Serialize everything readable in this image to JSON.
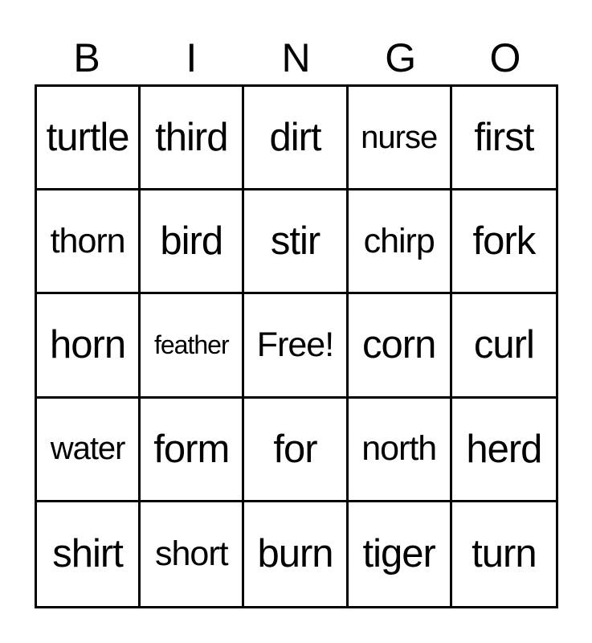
{
  "header": {
    "letters": [
      "B",
      "I",
      "N",
      "G",
      "O"
    ]
  },
  "board": {
    "rows": [
      [
        "turtle",
        "third",
        "dirt",
        "nurse",
        "first"
      ],
      [
        "thorn",
        "bird",
        "stir",
        "chirp",
        "fork"
      ],
      [
        "horn",
        "feather",
        "Free!",
        "corn",
        "curl"
      ],
      [
        "water",
        "form",
        "for",
        "north",
        "herd"
      ],
      [
        "shirt",
        "short",
        "burn",
        "tiger",
        "turn"
      ]
    ]
  }
}
